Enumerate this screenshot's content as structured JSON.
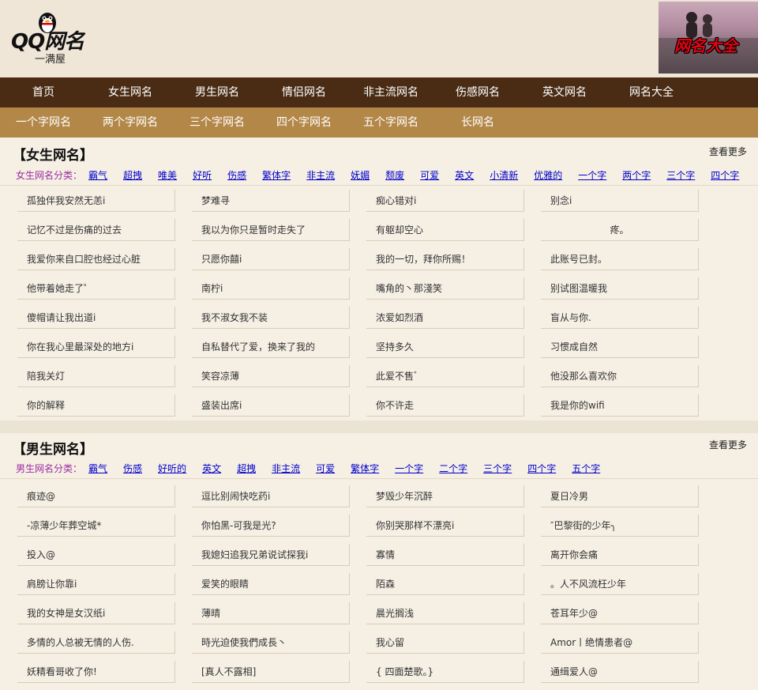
{
  "header": {
    "logo_text": "QQ网名",
    "logo_sub": "一满屋",
    "banner_text": "网名大全"
  },
  "nav_primary": [
    "首页",
    "女生网名",
    "男生网名",
    "情侣网名",
    "非主流网名",
    "伤感网名",
    "英文网名",
    "网名大全"
  ],
  "nav_secondary": [
    "一个字网名",
    "两个字网名",
    "三个字网名",
    "四个字网名",
    "五个字网名",
    "长网名"
  ],
  "female": {
    "title": "【女生网名】",
    "more": "查看更多",
    "cat_label": "女生网名分类：",
    "categories": [
      "霸气",
      "超拽",
      "唯美",
      "好听",
      "伤感",
      "繁体字",
      "非主流",
      "妩媚",
      "颓废",
      "可爱",
      "英文",
      "小清新",
      "优雅的",
      "一个字",
      "两个字",
      "三个字",
      "四个字"
    ],
    "names": [
      [
        "孤独伴我安然无恙i",
        "梦难寻",
        "痴心错对i",
        "别念i"
      ],
      [
        "记忆不过是伤痛的过去",
        "我以为你只是暂时走失了",
        "有躯却空心",
        "疼。"
      ],
      [
        "我爱你来自口腔也经过心脏",
        "只愿你囍i",
        "我的一切，拜你所赐！",
        "此账号已封。"
      ],
      [
        "他带着她走了゜",
        "南柠i",
        "嘴角的丶那淺笑",
        "别试图温暖我"
      ],
      [
        "傻帽请让我出道i",
        "我不淑女我不装",
        "浓爱如烈酒",
        "盲从与你."
      ],
      [
        "你在我心里最深处的地方i",
        "自私替代了爱，换来了我的",
        "坚持多久",
        "习惯成自然"
      ],
      [
        "陪我关灯",
        "笑容凉薄",
        "此爱不售゛",
        "他没那么喜欢你"
      ],
      [
        "你的解释",
        "盛装出席i",
        "你不许走",
        "我是你的wifi"
      ]
    ]
  },
  "male": {
    "title": "【男生网名】",
    "more": "查看更多",
    "cat_label": "男生网名分类：",
    "categories": [
      "霸气",
      "伤感",
      "好听的",
      "英文",
      "超拽",
      "非主流",
      "可爱",
      "繁体字",
      "一个字",
      "二个字",
      "三个字",
      "四个字",
      "五个字"
    ],
    "names": [
      [
        "痕迹@",
        "逗比别闹快吃药i",
        "梦毁少年沉醉",
        "夏日冷男"
      ],
      [
        "-凉薄少年葬空城*",
        "你怕黑-可我是光?",
        "你别哭那样不漂亮i",
        "″巴黎街的少年╮"
      ],
      [
        "投入@",
        "我媳妇追我兄弟说试探我i",
        "寡情",
        "离开你会痛"
      ],
      [
        "肩膀让你靠i",
        "爱笑的眼睛",
        "陌森",
        "。人不风流枉少年"
      ],
      [
        "我的女神是女汉纸i",
        "薄晴",
        "晨光搁浅",
        "苍耳年少@"
      ],
      [
        "多情的人总被无情的人伤.",
        "時光迫使我們成長丶",
        "我心留",
        "Amor丨绝情患者@"
      ],
      [
        "妖精看哥收了你!",
        "[真人不露相]",
        "{ 四面楚歌。}",
        "通缉爱人@"
      ]
    ]
  }
}
